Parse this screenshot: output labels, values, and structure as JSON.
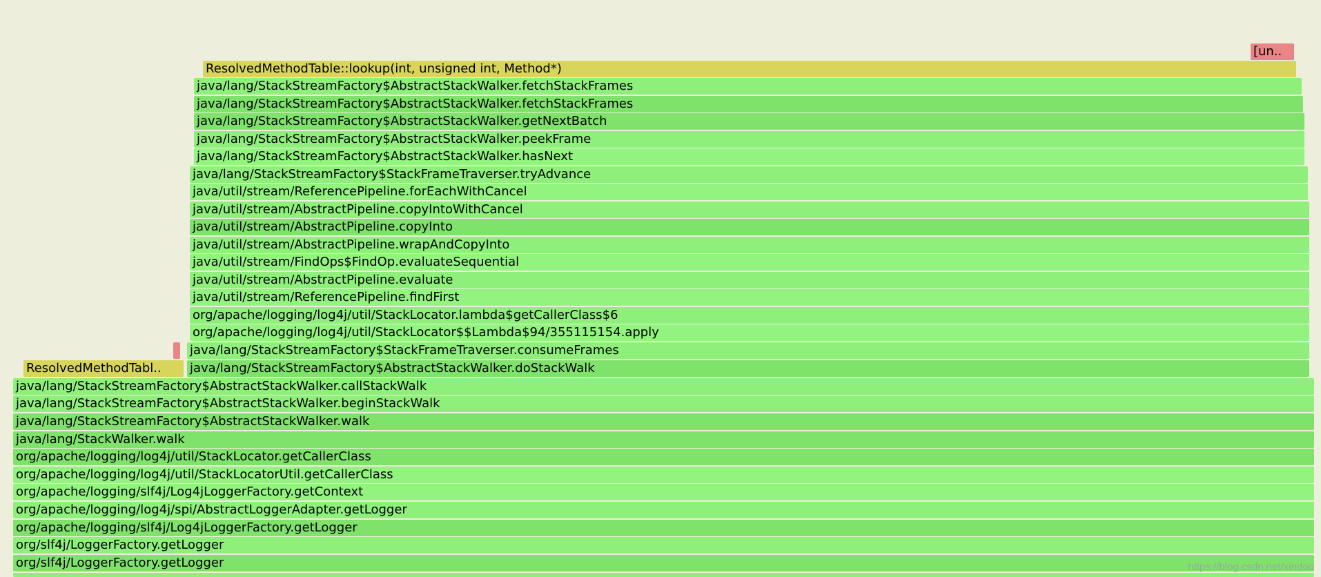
{
  "frames": [
    {
      "label": "[un..",
      "color": "r",
      "l": 1812,
      "w": 63,
      "t": 63
    },
    {
      "label": "ResolvedMethodTable::lookup(int, unsigned int, Method*)",
      "color": "y",
      "l": 294,
      "w": 1584,
      "t": 88
    },
    {
      "label": "java/lang/StackStreamFactory$AbstractStackWalker.fetchStackFrames",
      "color": "g1",
      "l": 281,
      "w": 1605,
      "t": 113
    },
    {
      "label": "java/lang/StackStreamFactory$AbstractStackWalker.fetchStackFrames",
      "color": "g2",
      "l": 281,
      "w": 1607,
      "t": 139
    },
    {
      "label": "java/lang/StackStreamFactory$AbstractStackWalker.getNextBatch",
      "color": "g2",
      "l": 281,
      "w": 1609,
      "t": 164
    },
    {
      "label": "java/lang/StackStreamFactory$AbstractStackWalker.peekFrame",
      "color": "g1",
      "l": 281,
      "w": 1609,
      "t": 190
    },
    {
      "label": "java/lang/StackStreamFactory$AbstractStackWalker.hasNext",
      "color": "g3",
      "l": 281,
      "w": 1609,
      "t": 215
    },
    {
      "label": "java/lang/StackStreamFactory$StackFrameTraverser.tryAdvance",
      "color": "g1",
      "l": 275,
      "w": 1620,
      "t": 241
    },
    {
      "label": "java/util/stream/ReferencePipeline.forEachWithCancel",
      "color": "g3",
      "l": 275,
      "w": 1620,
      "t": 266
    },
    {
      "label": "java/util/stream/AbstractPipeline.copyIntoWithCancel",
      "color": "g1",
      "l": 275,
      "w": 1622,
      "t": 292
    },
    {
      "label": "java/util/stream/AbstractPipeline.copyInto",
      "color": "g2",
      "l": 275,
      "w": 1622,
      "t": 317
    },
    {
      "label": "java/util/stream/AbstractPipeline.wrapAndCopyInto",
      "color": "g1",
      "l": 275,
      "w": 1622,
      "t": 343
    },
    {
      "label": "java/util/stream/FindOps$FindOp.evaluateSequential",
      "color": "g3",
      "l": 275,
      "w": 1622,
      "t": 368
    },
    {
      "label": "java/util/stream/AbstractPipeline.evaluate",
      "color": "g1",
      "l": 275,
      "w": 1622,
      "t": 394
    },
    {
      "label": "java/util/stream/ReferencePipeline.findFirst",
      "color": "g3",
      "l": 275,
      "w": 1622,
      "t": 419
    },
    {
      "label": "org/apache/logging/log4j/util/StackLocator.lambda$getCallerClass$6",
      "color": "g1",
      "l": 275,
      "w": 1622,
      "t": 445
    },
    {
      "label": "org/apache/logging/log4j/util/StackLocator$$Lambda$94/355115154.apply",
      "color": "g3",
      "l": 275,
      "w": 1622,
      "t": 470
    },
    {
      "label": "",
      "color": "r",
      "l": 251,
      "w": 10,
      "t": 496
    },
    {
      "label": "java/lang/StackStreamFactory$StackFrameTraverser.consumeFrames",
      "color": "g1",
      "l": 271,
      "w": 1626,
      "t": 496
    },
    {
      "label": "ResolvedMethodTabl..",
      "color": "y",
      "l": 34,
      "w": 232,
      "t": 522
    },
    {
      "label": "java/lang/StackStreamFactory$AbstractStackWalker.doStackWalk",
      "color": "g2",
      "l": 271,
      "w": 1626,
      "t": 522
    },
    {
      "label": "java/lang/StackStreamFactory$AbstractStackWalker.callStackWalk",
      "color": "g1",
      "l": 19,
      "w": 1885,
      "t": 548
    },
    {
      "label": "java/lang/StackStreamFactory$AbstractStackWalker.beginStackWalk",
      "color": "g1",
      "l": 19,
      "w": 1885,
      "t": 573
    },
    {
      "label": "java/lang/StackStreamFactory$AbstractStackWalker.walk",
      "color": "g2",
      "l": 19,
      "w": 1885,
      "t": 599
    },
    {
      "label": "java/lang/StackWalker.walk",
      "color": "g2",
      "l": 19,
      "w": 1885,
      "t": 625
    },
    {
      "label": "org/apache/logging/log4j/util/StackLocator.getCallerClass",
      "color": "g2",
      "l": 19,
      "w": 1885,
      "t": 650
    },
    {
      "label": "org/apache/logging/log4j/util/StackLocatorUtil.getCallerClass",
      "color": "g3",
      "l": 19,
      "w": 1885,
      "t": 676
    },
    {
      "label": "org/apache/logging/slf4j/Log4jLoggerFactory.getContext",
      "color": "g3",
      "l": 19,
      "w": 1885,
      "t": 701
    },
    {
      "label": "org/apache/logging/log4j/spi/AbstractLoggerAdapter.getLogger",
      "color": "g1",
      "l": 19,
      "w": 1885,
      "t": 727
    },
    {
      "label": "org/apache/logging/slf4j/Log4jLoggerFactory.getLogger",
      "color": "g2",
      "l": 19,
      "w": 1885,
      "t": 753
    },
    {
      "label": "org/slf4j/LoggerFactory.getLogger",
      "color": "g1",
      "l": 19,
      "w": 1885,
      "t": 778
    },
    {
      "label": "org/slf4j/LoggerFactory.getLogger",
      "color": "g2",
      "l": 19,
      "w": 1885,
      "t": 804
    },
    {
      "label": "",
      "color": "g1",
      "l": 19,
      "w": 1885,
      "t": 830
    }
  ],
  "watermark": "https://blog.csdn.net/xindoo"
}
